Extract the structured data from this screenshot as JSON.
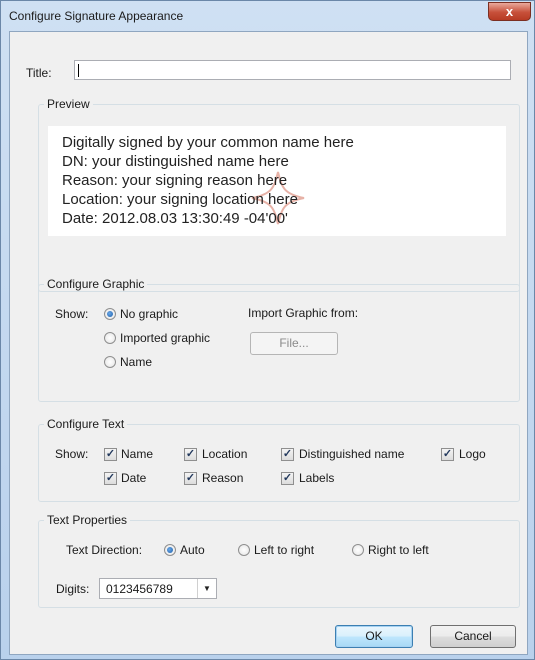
{
  "window": {
    "title": "Configure Signature Appearance",
    "close_glyph": "x"
  },
  "title_field": {
    "label": "Title:",
    "value": ""
  },
  "preview": {
    "heading": "Preview",
    "lines": [
      "Digitally signed by your common name here",
      "DN: your distinguished name here",
      "Reason: your signing reason here",
      "Location: your signing location here",
      "Date: 2012.08.03 13:30:49 -04'00'"
    ]
  },
  "configure_graphic": {
    "heading": "Configure Graphic",
    "show_label": "Show:",
    "options": [
      {
        "label": "No graphic",
        "selected": true
      },
      {
        "label": "Imported graphic",
        "selected": false
      },
      {
        "label": "Name",
        "selected": false
      }
    ],
    "import_label": "Import Graphic from:",
    "file_button": "File..."
  },
  "configure_text": {
    "heading": "Configure Text",
    "show_label": "Show:",
    "checkboxes": [
      {
        "label": "Name",
        "checked": true
      },
      {
        "label": "Location",
        "checked": true
      },
      {
        "label": "Distinguished name",
        "checked": true
      },
      {
        "label": "Logo",
        "checked": true
      },
      {
        "label": "Date",
        "checked": true
      },
      {
        "label": "Reason",
        "checked": true
      },
      {
        "label": "Labels",
        "checked": true
      }
    ]
  },
  "text_properties": {
    "heading": "Text Properties",
    "direction_label": "Text Direction:",
    "directions": [
      {
        "label": "Auto",
        "selected": true
      },
      {
        "label": "Left to right",
        "selected": false
      },
      {
        "label": "Right to left",
        "selected": false
      }
    ],
    "digits_label": "Digits:",
    "digits_value": "0123456789"
  },
  "buttons": {
    "ok": "OK",
    "cancel": "Cancel"
  },
  "icons": {
    "check": "checkmark-glyph",
    "dropdown": "chevron-down-icon",
    "close": "close-icon"
  },
  "colors": {
    "accent": "#3c7fb1",
    "watermark": "#d98a7a"
  }
}
